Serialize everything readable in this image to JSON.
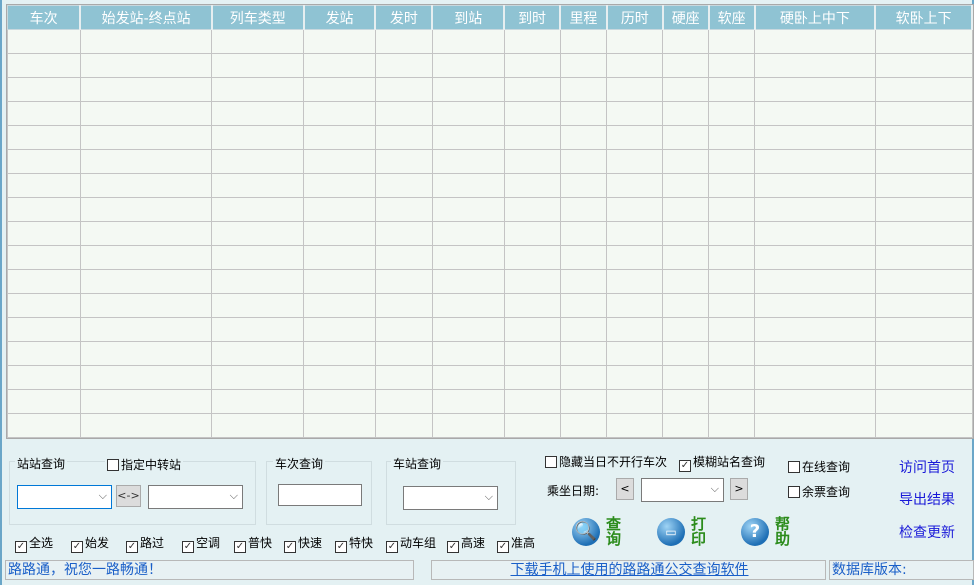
{
  "grid": {
    "columns": [
      "车次",
      "始发站-终点站",
      "列车类型",
      "发站",
      "发时",
      "到站",
      "到时",
      "里程",
      "历时",
      "硬座",
      "软座",
      "硬卧上中下",
      "软卧上下"
    ],
    "rows": []
  },
  "station_query": {
    "title": "站站查询",
    "transfer_label": "指定中转站",
    "transfer_checked": false,
    "from_value": "",
    "to_value": "",
    "swap_label": "<->"
  },
  "train_query": {
    "title": "车次查询",
    "value": ""
  },
  "stop_query": {
    "title": "车站查询",
    "value": ""
  },
  "filters": [
    {
      "label": "全选",
      "checked": true
    },
    {
      "label": "始发",
      "checked": true
    },
    {
      "label": "路过",
      "checked": true
    },
    {
      "label": "空调",
      "checked": true
    },
    {
      "label": "普快",
      "checked": true
    },
    {
      "label": "快速",
      "checked": true
    },
    {
      "label": "特快",
      "checked": true
    },
    {
      "label": "动车组",
      "checked": true
    },
    {
      "label": "高速",
      "checked": true
    },
    {
      "label": "准高",
      "checked": true
    }
  ],
  "options": {
    "hide_label": "隐藏当日不开行车次",
    "hide_checked": false,
    "fuzzy_label": "模糊站名查询",
    "fuzzy_checked": true,
    "online_label": "在线查询",
    "online_checked": false,
    "ticket_label": "余票查询",
    "ticket_checked": false
  },
  "date": {
    "label": "乘坐日期:",
    "prev": "<",
    "next": ">",
    "value": ""
  },
  "actions": {
    "query": "查询",
    "print": "打印",
    "help": "帮助"
  },
  "links": {
    "home": "访问首页",
    "export": "导出结果",
    "update": "检查更新"
  },
  "status": {
    "greeting": "路路通，祝您一路畅通！",
    "download": "下载手机上使用的路路通公交查询软件",
    "db_version": "数据库版本:"
  }
}
